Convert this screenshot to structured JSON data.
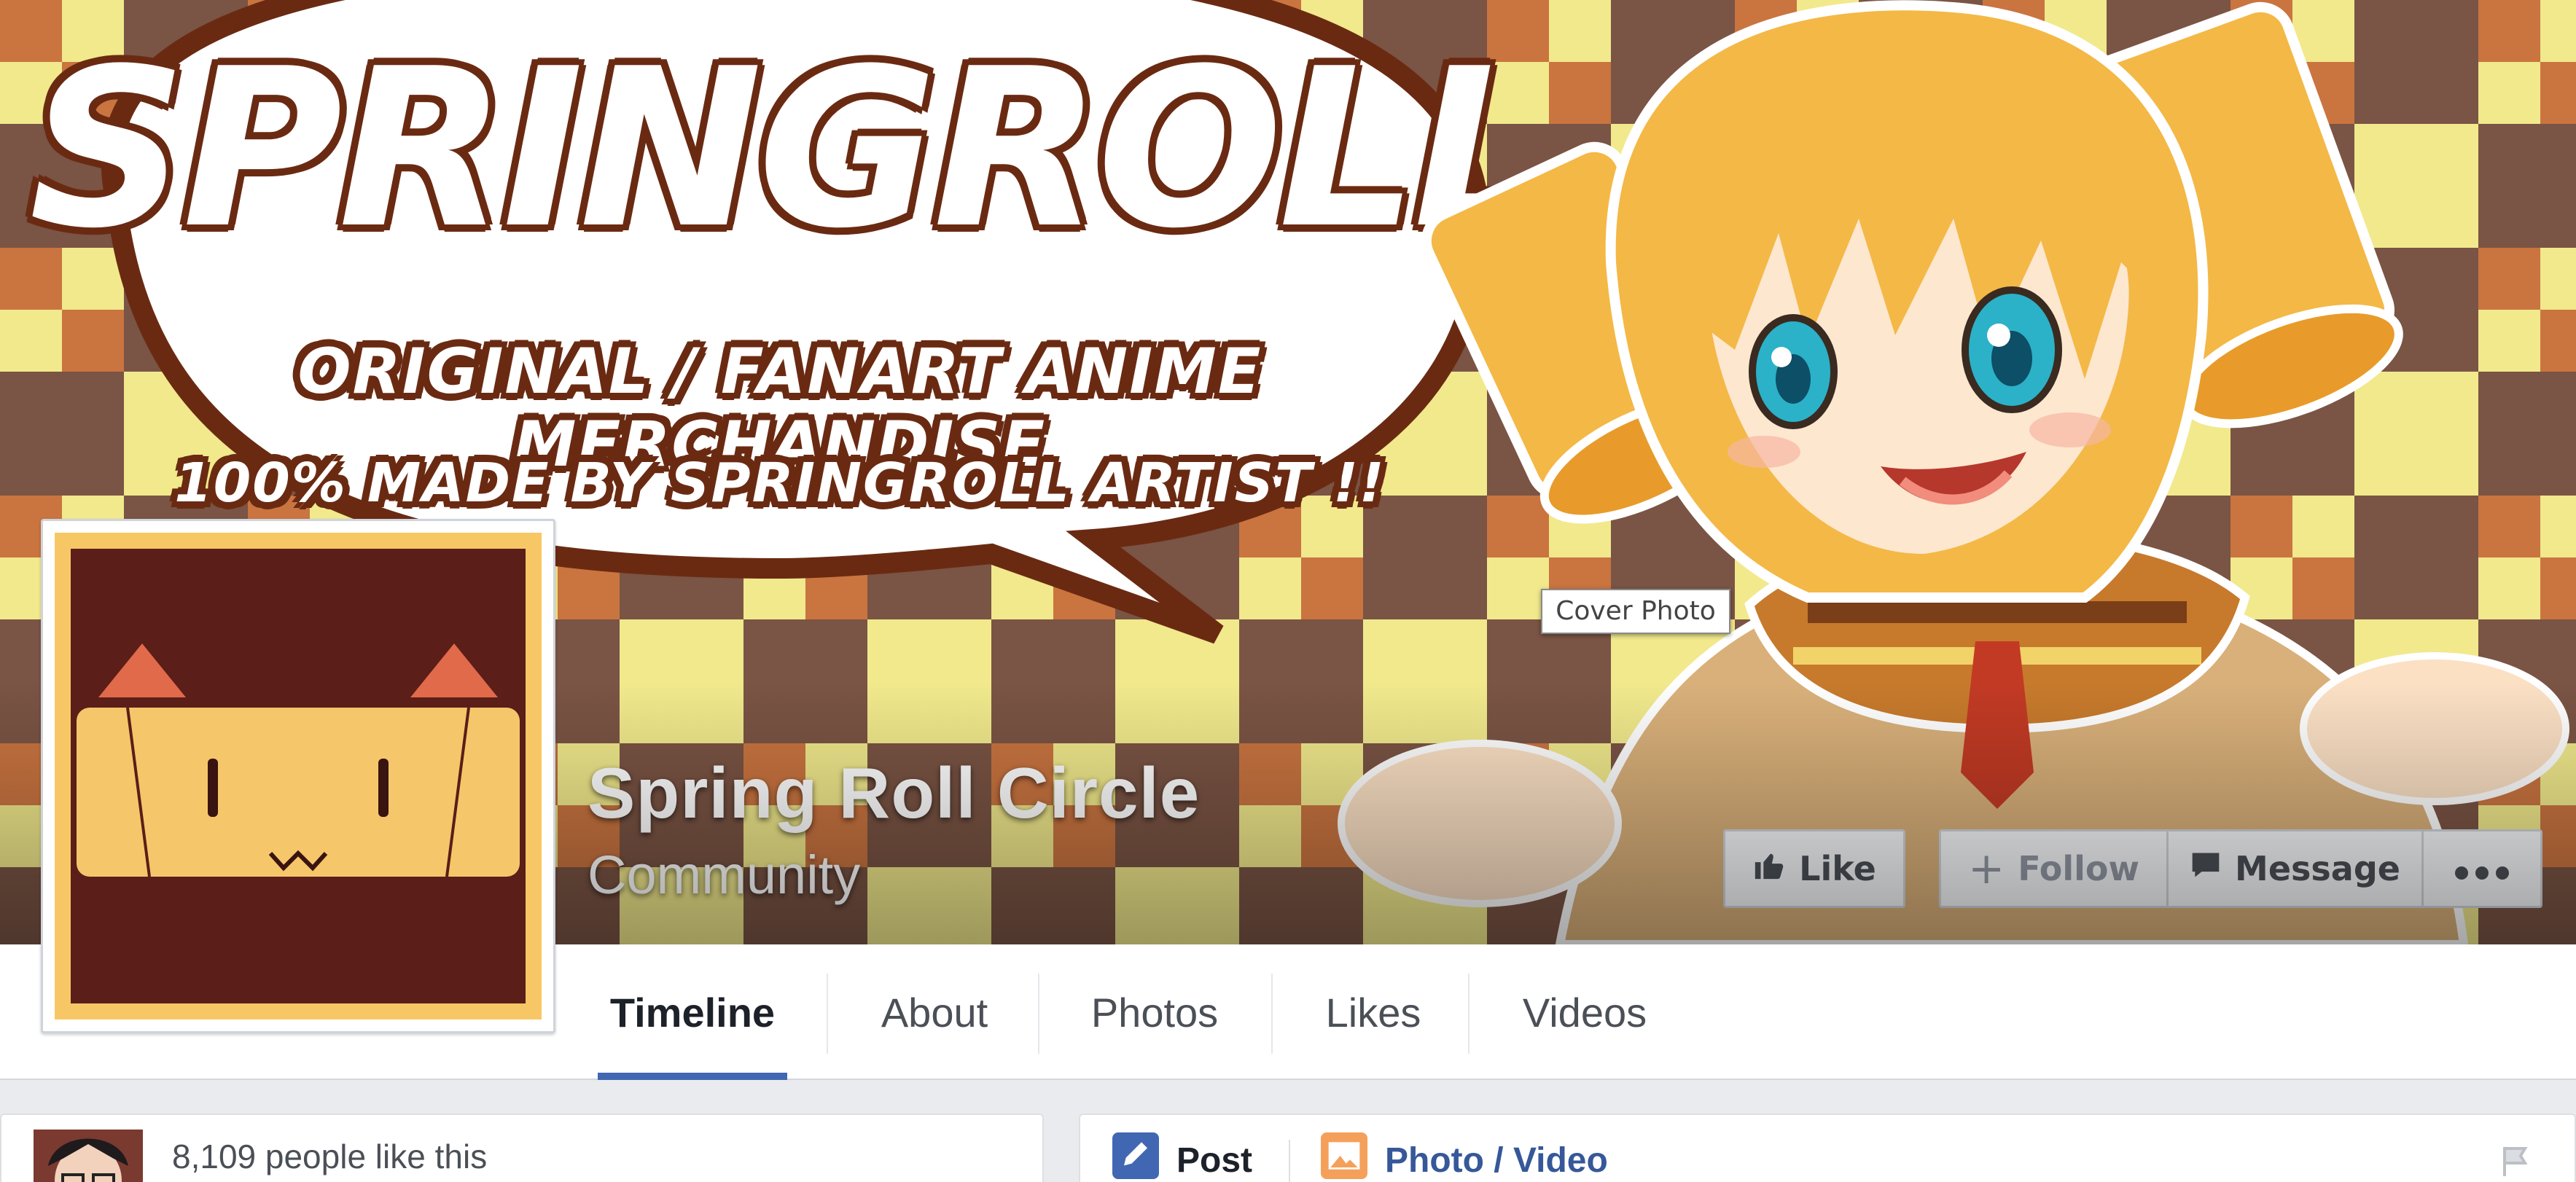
{
  "cover": {
    "banner": {
      "title": "SPRINGROLL",
      "line1": "ORIGINAL / FANART ANIME MERCHANDISE",
      "line2": "100% MADE BY SPRINGROLL ARTIST !!"
    },
    "tooltip": "Cover Photo"
  },
  "page": {
    "name": "Spring Roll Circle",
    "category": "Community"
  },
  "actions": {
    "like_label": "Like",
    "follow_label": "Follow",
    "message_label": "Message",
    "more_icon": "ellipsis-icon"
  },
  "nav": {
    "tabs": [
      {
        "label": "Timeline",
        "active": true
      },
      {
        "label": "About"
      },
      {
        "label": "Photos"
      },
      {
        "label": "Likes"
      },
      {
        "label": "Videos"
      }
    ]
  },
  "sidebar": {
    "likes_text": "8,109 people like this"
  },
  "composer": {
    "post_label": "Post",
    "photo_video_label": "Photo / Video"
  },
  "colors": {
    "accent": "#4267b2",
    "link": "#365899",
    "page_bg": "#e9ebee"
  }
}
